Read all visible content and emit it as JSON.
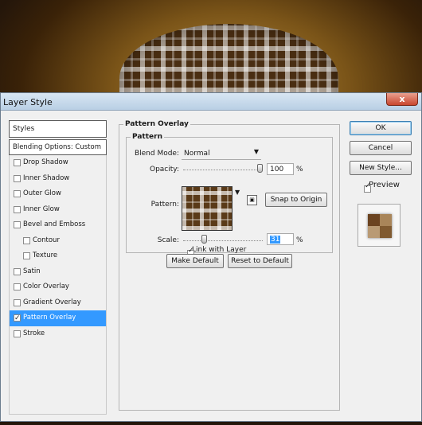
{
  "window": {
    "title": "Layer Style",
    "close_glyph": "x"
  },
  "styles_list": {
    "header": "Styles",
    "blending_options": "Blending Options: Custom",
    "items": [
      {
        "label": "Drop Shadow",
        "checked": false,
        "sub": false,
        "selected": false
      },
      {
        "label": "Inner Shadow",
        "checked": false,
        "sub": false,
        "selected": false
      },
      {
        "label": "Outer Glow",
        "checked": false,
        "sub": false,
        "selected": false
      },
      {
        "label": "Inner Glow",
        "checked": false,
        "sub": false,
        "selected": false
      },
      {
        "label": "Bevel and Emboss",
        "checked": false,
        "sub": false,
        "selected": false
      },
      {
        "label": "Contour",
        "checked": false,
        "sub": true,
        "selected": false
      },
      {
        "label": "Texture",
        "checked": false,
        "sub": true,
        "selected": false
      },
      {
        "label": "Satin",
        "checked": false,
        "sub": false,
        "selected": false
      },
      {
        "label": "Color Overlay",
        "checked": false,
        "sub": false,
        "selected": false
      },
      {
        "label": "Gradient Overlay",
        "checked": false,
        "sub": false,
        "selected": false
      },
      {
        "label": "Pattern Overlay",
        "checked": true,
        "sub": false,
        "selected": true
      },
      {
        "label": "Stroke",
        "checked": false,
        "sub": false,
        "selected": false
      }
    ]
  },
  "pattern_overlay": {
    "group_title": "Pattern Overlay",
    "sub_title": "Pattern",
    "blend_mode_label": "Blend Mode:",
    "blend_mode_value": "Normal",
    "opacity_label": "Opacity:",
    "opacity_value": "100",
    "opacity_unit": "%",
    "pattern_label": "Pattern:",
    "snap_button": "Snap to Origin",
    "scale_label": "Scale:",
    "scale_value": "31",
    "scale_unit": "%",
    "link_label": "Link with Layer",
    "link_checked": true,
    "make_default": "Make Default",
    "reset_default": "Reset to Default"
  },
  "actions": {
    "ok": "OK",
    "cancel": "Cancel",
    "new_style": "New Style...",
    "preview_label": "Preview",
    "preview_checked": true
  },
  "colors": {
    "selection": "#3399ff",
    "titlebar": "#c8daec",
    "background_brown": "#5a3a18"
  }
}
